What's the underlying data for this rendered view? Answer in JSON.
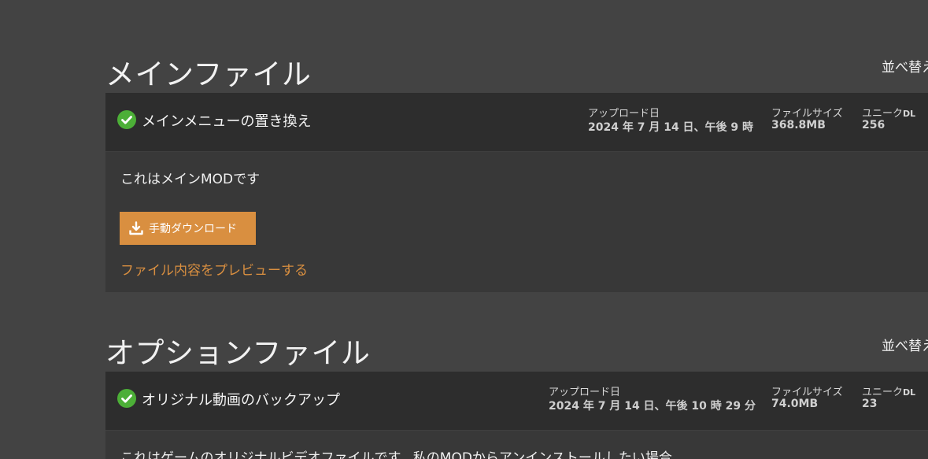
{
  "main_section": {
    "title": "メインファイル",
    "sort_label": "並べ替え",
    "file": {
      "name": "メインメニューの置き換え",
      "upload_label": "アップロード日",
      "upload_value": "2024 年 7 月 14 日、午後 9 時",
      "size_label": "ファイルサイズ",
      "size_value": "368.8MB",
      "unique_label": "ユニーク",
      "unique_suffix": "DL",
      "unique_value": "256",
      "description": "これはメインMODです",
      "download_label": "手動ダウンロード",
      "preview_label": "ファイル内容をプレビューする"
    }
  },
  "optional_section": {
    "title": "オプションファイル",
    "sort_label": "並べ替え",
    "file": {
      "name": "オリジナル動画のバックアップ",
      "upload_label": "アップロード日",
      "upload_value": "2024 年 7 月 14 日、午後 10 時 29 分",
      "size_label": "ファイルサイズ",
      "size_value": "74.0MB",
      "unique_label": "ユニーク",
      "unique_suffix": "DL",
      "unique_value": "23",
      "description": "これはゲームのオリジナルビデオファイルです。私のMODからアンインストールしたい場合"
    }
  },
  "colors": {
    "background": "#434343",
    "header": "#2d2d2d",
    "body": "#383838",
    "accent": "#d98f40",
    "check": "#4caf37"
  },
  "icons": {
    "status": "check-circle-icon",
    "download": "download-icon"
  }
}
